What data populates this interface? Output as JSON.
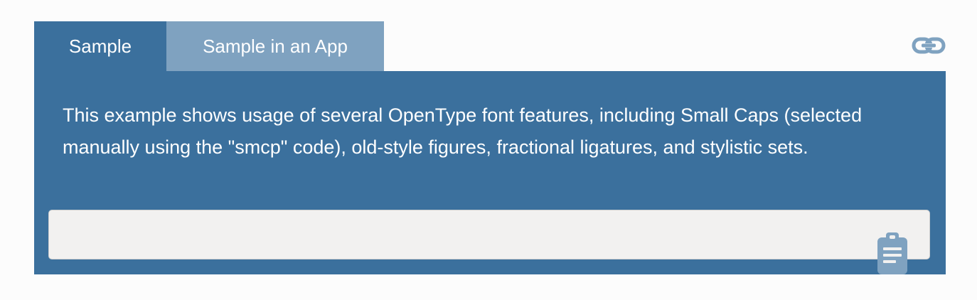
{
  "tabs": [
    {
      "label": "Sample",
      "active": true
    },
    {
      "label": "Sample in an App",
      "active": false
    }
  ],
  "icons": {
    "link": "link-icon",
    "clipboard": "clipboard-icon"
  },
  "panel": {
    "description": "This example shows usage of several OpenType font features, including Small Caps (selected manually using the \"smcp\" code), old-style figures, fractional ligatures, and stylistic sets.",
    "code": ""
  },
  "colors": {
    "active_tab": "#3b709d",
    "inactive_tab": "#7fa2c0",
    "panel": "#3b709d",
    "code_background": "#f2f1f0",
    "icon": "#7fa2c0"
  }
}
